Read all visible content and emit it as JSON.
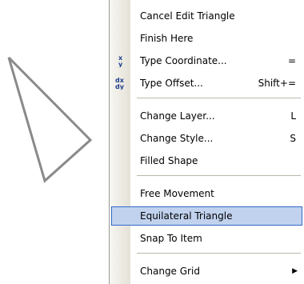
{
  "context_menu": {
    "items": [
      {
        "label": "Cancel Edit Triangle",
        "shortcut": ""
      },
      {
        "label": "Finish Here",
        "shortcut": ""
      },
      {
        "label": "Type Coordinate...",
        "shortcut": "=",
        "icon": "xy-coordinate-icon"
      },
      {
        "label": "Type Offset...",
        "shortcut": "Shift+=",
        "icon": "dx-dy-offset-icon"
      },
      {
        "label": "Change Layer...",
        "shortcut": "L"
      },
      {
        "label": "Change Style...",
        "shortcut": "S"
      },
      {
        "label": "Filled Shape",
        "shortcut": ""
      },
      {
        "label": "Free Movement",
        "shortcut": ""
      },
      {
        "label": "Equilateral Triangle",
        "shortcut": "",
        "highlighted": true
      },
      {
        "label": "Snap To Item",
        "shortcut": ""
      },
      {
        "label": "Change Grid",
        "shortcut": "",
        "submenu": true
      }
    ],
    "icon_glyphs": {
      "xy": "x\ny",
      "dxdy": "dx\ndy"
    },
    "submenu_arrow": "▶"
  },
  "colors": {
    "highlight_bg": "#c1d2ee",
    "highlight_border": "#316ac5",
    "triangle_stroke": "#8a8a8a",
    "icon_color": "#1f3f8f"
  }
}
